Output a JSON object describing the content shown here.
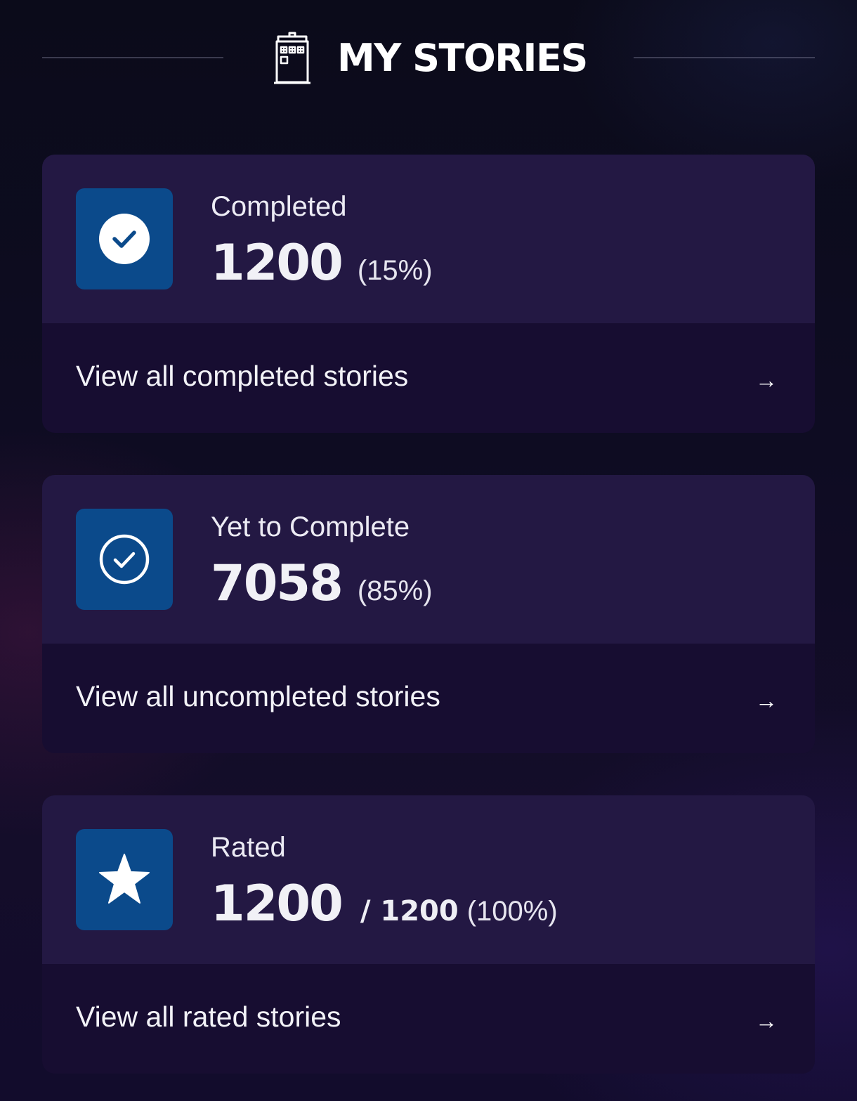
{
  "header": {
    "title": "MY STORIES",
    "icon": "tardis-icon"
  },
  "colors": {
    "card_top": "#231843",
    "card_bottom": "#170d31",
    "icon_box": "#0b4a8b",
    "background": "#0e0c22"
  },
  "cards": [
    {
      "label": "Completed",
      "value": "1200",
      "total": "",
      "percent": "(15%)",
      "icon": "check-circle-filled-icon",
      "link_text": "View all completed stories",
      "arrow": "→"
    },
    {
      "label": "Yet to Complete",
      "value": "7058",
      "total": "",
      "percent": "(85%)",
      "icon": "check-circle-outline-icon",
      "link_text": "View all uncompleted stories",
      "arrow": "→"
    },
    {
      "label": "Rated",
      "value": "1200",
      "total": "/ 1200",
      "percent": "(100%)",
      "icon": "star-icon",
      "link_text": "View all rated stories",
      "arrow": "→"
    }
  ]
}
